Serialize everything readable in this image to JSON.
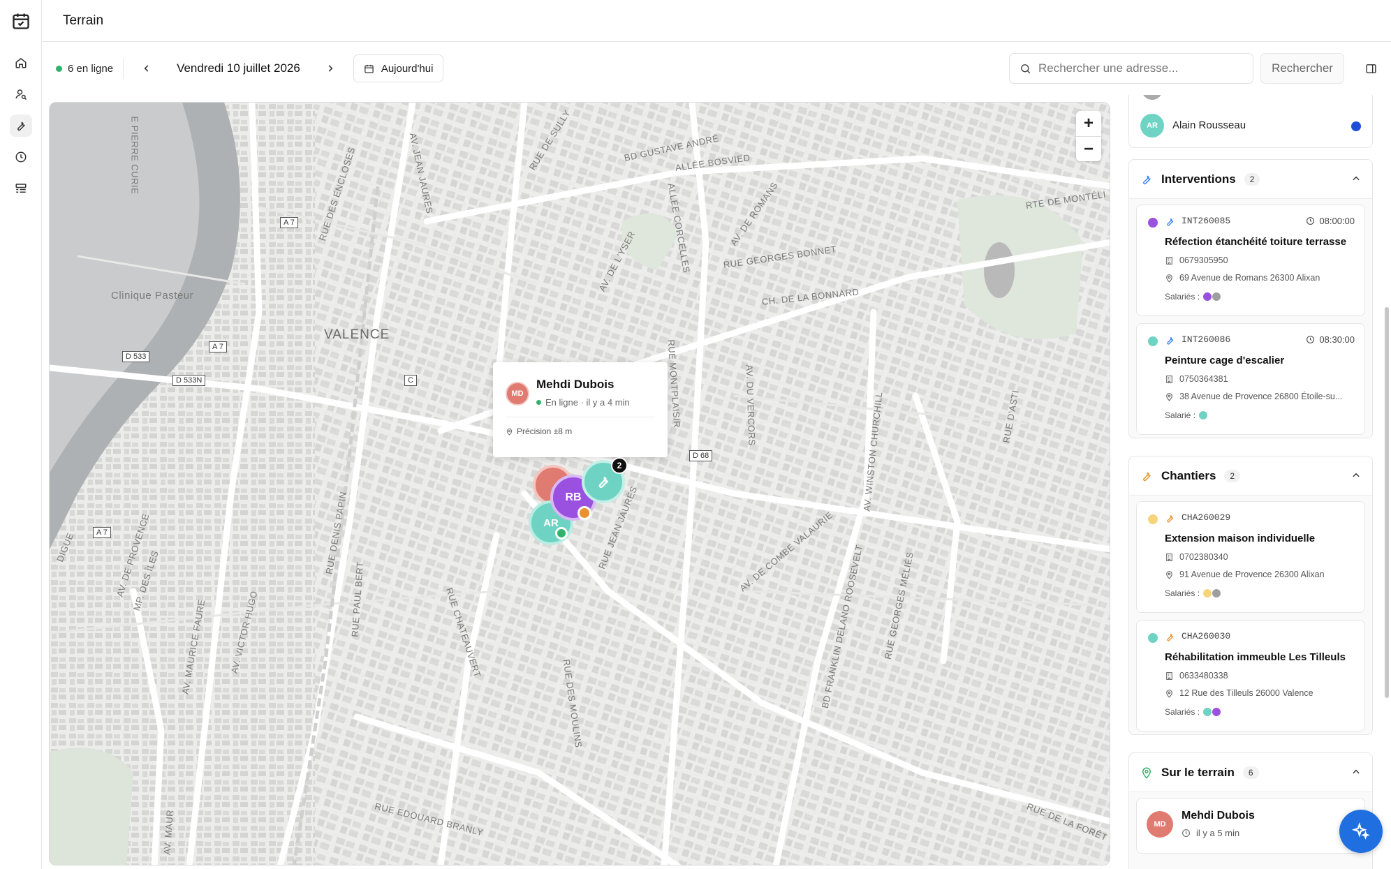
{
  "app": {
    "title": "Terrain"
  },
  "sidebar": {
    "items": [
      {
        "icon": "home-icon"
      },
      {
        "icon": "user-search-icon"
      },
      {
        "icon": "wrench-icon"
      },
      {
        "icon": "clock-icon"
      },
      {
        "icon": "list-icon"
      }
    ]
  },
  "toolbar": {
    "online_count": "6 en ligne",
    "date": "Vendredi 10 juillet 2026",
    "today_label": "Aujourd'hui",
    "search_placeholder": "Rechercher une adresse...",
    "search_button": "Rechercher"
  },
  "map": {
    "labels": {
      "valence": "VALENCE",
      "clinique": "Clinique Pasteur",
      "bd_gustave_andre": "BD GUSTAVE ANDRÉ",
      "allee_bosvied": "ALLÉE BOSVIED",
      "rue_de_sully": "RUE DE SULLY",
      "av_jean_jaures": "AV. JEAN JAURÈS",
      "rue_des_enclos": "RUE DES ENCLOSES",
      "pierre_curie": "E PIERRE CURIE",
      "allee_corcelles": "ALLÉE CORCELLES",
      "av_de_romans": "AV. DE ROMANS",
      "rte_de_montelier": "RTE DE MONTÉLI",
      "rue_georges_bonnet": "RUE GEORGES BONNET",
      "av_de_lyser": "AV. DE L'YSER",
      "ch_bonnard": "CH. DE LA BONNARD",
      "rue_montplaisir": "RUE MONTPLAISIR",
      "av_du_vercors": "AV. DU VERCORS",
      "av_winston_churchill": "AV. WINSTON CHURCHILL",
      "rue_dasti": "RUE D'ASTI",
      "rue_jean_jaures": "RUE JEAN JAURÈS",
      "rue_denis_papin": "RUE DENIS PAPIN",
      "rue_paul_bert": "RUE PAUL BERT",
      "rue_chateauvert": "RUE CHATEAUVERT",
      "rue_des_moulins": "RUE DES MOULINS",
      "av_de_combe": "AV. DE COMBE VALAURIE",
      "bd_roosevelt": "BD FRANKLIN DELANO ROOSEVELT",
      "rue_georges_melies": "RUE GEORGES MÉLIÈS",
      "rue_de_la_foret": "RUE DE LA FORÊT",
      "rue_edouard_branly": "RUE EDOUARD BRANLY",
      "av_victor_hugo": "AV. VICTOR HUGO",
      "av_maurice_faure": "AV. MAURICE FAURE",
      "av_de_provence": "AV. DE PROVENCE",
      "mp_des_iles": "MP. DES ÎLES",
      "digue": "DIGUE",
      "av_maur": "AV. MAUR"
    },
    "badges": {
      "a7_1": "A 7",
      "a7_2": "A 7",
      "a7_3": "A 7",
      "d533": "D 533",
      "d533n": "D 533N",
      "c": "C",
      "d68": "D 68"
    },
    "popup": {
      "initials": "MD",
      "name": "Mehdi Dubois",
      "status": "En ligne · il y a 4 min",
      "precision": "Précision ±8 m"
    },
    "markers": {
      "rb": "RB",
      "ar": "AR",
      "cluster_count": "2"
    }
  },
  "panel": {
    "top_user": {
      "initials": "AR",
      "name": "Alain Rousseau"
    },
    "interventions": {
      "title": "Interventions",
      "count": "2",
      "items": [
        {
          "code": "INT260085",
          "time": "08:00:00",
          "title": "Réfection étanchéité toiture terrasse",
          "phone": "0679305950",
          "address": "69 Avenue de Romans 26300 Alixan",
          "staff_label": "Salariés :"
        },
        {
          "code": "INT260086",
          "time": "08:30:00",
          "title": "Peinture cage d'escalier",
          "phone": "0750364381",
          "address": "38 Avenue de Provence 26800 Étoile-su...",
          "staff_label": "Salarié :"
        }
      ]
    },
    "chantiers": {
      "title": "Chantiers",
      "count": "2",
      "items": [
        {
          "code": "CHA260029",
          "title": "Extension maison individuelle",
          "phone": "0702380340",
          "address": "91 Avenue de Provence 26300 Alixan",
          "staff_label": "Salariés :"
        },
        {
          "code": "CHA260030",
          "title": "Réhabilitation immeuble Les Tilleuls",
          "phone": "0633480338",
          "address": "12 Rue des Tilleuls 26000 Valence",
          "staff_label": "Salariés :"
        }
      ]
    },
    "terrain": {
      "title": "Sur le terrain",
      "count": "6",
      "first": {
        "initials": "MD",
        "name": "Mehdi Dubois",
        "time": "il y a 5 min"
      }
    }
  },
  "colors": {
    "online": "#2fb36b",
    "purple": "#9b51e0",
    "teal": "#6fd3c3",
    "coral": "#e07b72",
    "orange": "#e9912f",
    "yellow": "#f6d57a",
    "grey": "#9e9e9e",
    "blue_accent": "#1f6fe0"
  }
}
